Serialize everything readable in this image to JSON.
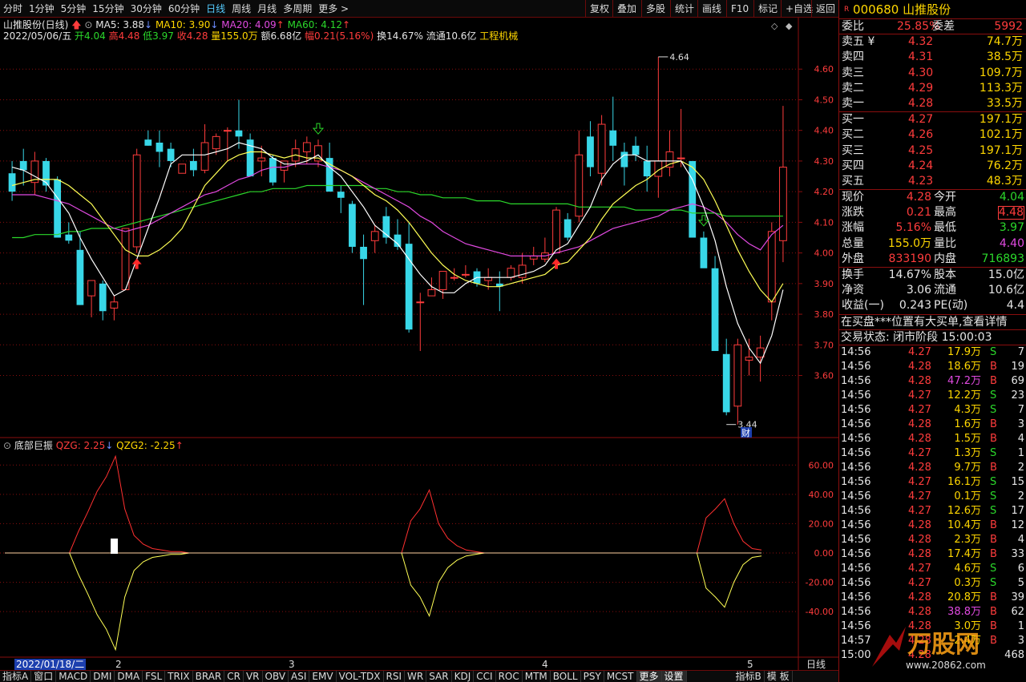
{
  "toolbar": {
    "timeframes": [
      "分时",
      "1分钟",
      "5分钟",
      "15分钟",
      "30分钟",
      "60分钟",
      "日线",
      "周线",
      "月线",
      "多周期",
      "更多 >"
    ],
    "active_timeframe": "日线",
    "buttons": [
      "复权",
      "叠加",
      "多股",
      "统计",
      "画线",
      "F10",
      "标记",
      "+自选",
      "返回"
    ]
  },
  "header": {
    "name_line": "山推股份(日线)",
    "ma5": "MA5: 3.88",
    "ma10": "MA10: 3.90",
    "ma20": "MA20: 4.09",
    "ma60": "MA60: 4.12",
    "date": "2022/05/06/五",
    "open": "开4.04",
    "high": "高4.48",
    "low": "低3.97",
    "close": "收4.28",
    "vol": "量155.0万",
    "amt": "额6.68亿",
    "amp": "幅0.21(5.16%)",
    "turn": "换14.67%",
    "float": "流通10.6亿",
    "industry": "工程机械"
  },
  "indicator": {
    "name": "底部巨振",
    "qzg": "QZG: 2.25",
    "qzg2": "QZG2: -2.25"
  },
  "price_axis": [
    "4.60",
    "4.50",
    "4.40",
    "4.30",
    "4.20",
    "4.10",
    "4.00",
    "3.90",
    "3.80",
    "3.70",
    "3.60"
  ],
  "ind_axis": [
    "60.00",
    "40.00",
    "20.00",
    "0.00",
    "-20.00",
    "-40.00"
  ],
  "annotations": {
    "high": "4.64",
    "low": "3.44",
    "cai": "财"
  },
  "date_strip": {
    "cursor_date": "2022/01/18/二",
    "months": [
      "2",
      "3",
      "4",
      "5"
    ],
    "corner": "日线"
  },
  "bottom_tabs": [
    "指标A",
    "窗口",
    "MACD",
    "DMI",
    "DMA",
    "FSL",
    "TRIX",
    "BRAR",
    "CR",
    "VR",
    "OBV",
    "ASI",
    "EMV",
    "VOL-TDX",
    "RSI",
    "WR",
    "SAR",
    "KDJ",
    "CCI",
    "ROC",
    "MTM",
    "BOLL",
    "PSY",
    "MCST",
    "更多",
    "设置",
    "指标B",
    "模 板"
  ],
  "stock": {
    "code": "000680",
    "name": "山推股份",
    "badge": "R"
  },
  "weibi": {
    "label1": "委比",
    "value1": "25.85%",
    "label2": "委差",
    "value2": "5992"
  },
  "asks": [
    {
      "label": "卖五 ¥",
      "price": "4.32",
      "vol": "74.7万"
    },
    {
      "label": "卖四",
      "price": "4.31",
      "vol": "38.5万"
    },
    {
      "label": "卖三",
      "price": "4.30",
      "vol": "109.7万"
    },
    {
      "label": "卖二",
      "price": "4.29",
      "vol": "113.3万"
    },
    {
      "label": "卖一",
      "price": "4.28",
      "vol": "33.5万"
    }
  ],
  "bids": [
    {
      "label": "买一",
      "price": "4.27",
      "vol": "197.1万"
    },
    {
      "label": "买二",
      "price": "4.26",
      "vol": "102.1万"
    },
    {
      "label": "买三",
      "price": "4.25",
      "vol": "197.1万"
    },
    {
      "label": "买四",
      "price": "4.24",
      "vol": "76.2万"
    },
    {
      "label": "买五",
      "price": "4.23",
      "vol": "48.3万"
    }
  ],
  "quote": [
    {
      "l1": "现价",
      "v1": "4.28",
      "c1": "red",
      "l2": "今开",
      "v2": "4.04",
      "c2": "grn"
    },
    {
      "l1": "涨跌",
      "v1": "0.21",
      "c1": "red",
      "l2": "最高",
      "v2": "4.48",
      "c2": "red",
      "box": true
    },
    {
      "l1": "涨幅",
      "v1": "5.16%",
      "c1": "red",
      "l2": "最低",
      "v2": "3.97",
      "c2": "grn"
    },
    {
      "l1": "总量",
      "v1": "155.0万",
      "c1": "yel",
      "l2": "量比",
      "v2": "4.40",
      "c2": "mag"
    },
    {
      "l1": "外盘",
      "v1": "833190",
      "c1": "red",
      "l2": "内盘",
      "v2": "716893",
      "c2": "grn"
    }
  ],
  "stats": [
    {
      "l1": "换手",
      "v1": "14.67%",
      "l2": "股本",
      "v2": "15.0亿"
    },
    {
      "l1": "净资",
      "v1": "3.06",
      "l2": "流通",
      "v2": "10.6亿"
    },
    {
      "l1": "收益(一)",
      "v1": "0.243",
      "l2": "PE(动)",
      "v2": "4.4"
    }
  ],
  "notice": "在买盘***位置有大买单,查看详情",
  "status": "交易状态: 闭市阶段 15:00:03",
  "ticks": [
    {
      "t": "14:56",
      "p": "4.27",
      "v": "17.9万",
      "s": "S",
      "n": "7"
    },
    {
      "t": "14:56",
      "p": "4.28",
      "v": "18.6万",
      "s": "B",
      "n": "19"
    },
    {
      "t": "14:56",
      "p": "4.28",
      "v": "47.2万",
      "s": "B",
      "n": "69"
    },
    {
      "t": "14:56",
      "p": "4.27",
      "v": "12.2万",
      "s": "S",
      "n": "23"
    },
    {
      "t": "14:56",
      "p": "4.27",
      "v": "4.3万",
      "s": "S",
      "n": "7"
    },
    {
      "t": "14:56",
      "p": "4.28",
      "v": "1.6万",
      "s": "B",
      "n": "3"
    },
    {
      "t": "14:56",
      "p": "4.28",
      "v": "1.5万",
      "s": "B",
      "n": "4"
    },
    {
      "t": "14:56",
      "p": "4.27",
      "v": "1.3万",
      "s": "S",
      "n": "1"
    },
    {
      "t": "14:56",
      "p": "4.28",
      "v": "9.7万",
      "s": "B",
      "n": "2"
    },
    {
      "t": "14:56",
      "p": "4.27",
      "v": "16.1万",
      "s": "S",
      "n": "15"
    },
    {
      "t": "14:56",
      "p": "4.27",
      "v": "0.1万",
      "s": "S",
      "n": "2"
    },
    {
      "t": "14:56",
      "p": "4.27",
      "v": "12.6万",
      "s": "S",
      "n": "17"
    },
    {
      "t": "14:56",
      "p": "4.28",
      "v": "10.4万",
      "s": "B",
      "n": "12"
    },
    {
      "t": "14:56",
      "p": "4.28",
      "v": "2.3万",
      "s": "B",
      "n": "4"
    },
    {
      "t": "14:56",
      "p": "4.28",
      "v": "17.4万",
      "s": "B",
      "n": "33"
    },
    {
      "t": "14:56",
      "p": "4.27",
      "v": "4.6万",
      "s": "S",
      "n": "6"
    },
    {
      "t": "14:56",
      "p": "4.27",
      "v": "0.3万",
      "s": "S",
      "n": "5"
    },
    {
      "t": "14:56",
      "p": "4.28",
      "v": "20.8万",
      "s": "B",
      "n": "39"
    },
    {
      "t": "14:56",
      "p": "4.28",
      "v": "38.8万",
      "s": "B",
      "n": "62"
    },
    {
      "t": "14:56",
      "p": "4.28",
      "v": "3.0万",
      "s": "B",
      "n": "1"
    },
    {
      "t": "14:57",
      "p": "4.28",
      "v": "2.4万",
      "s": "B",
      "n": "3"
    },
    {
      "t": "15:00",
      "p": "4.28",
      "v": "",
      "s": "",
      "n": "468"
    }
  ],
  "colors": {
    "up": "#ff3c3c",
    "down": "#38d7e8",
    "ma5": "#ffffff",
    "ma10": "#ffff55",
    "ma20": "#e14ae1",
    "ma60": "#2bd82b",
    "grid": "#8a0e0e"
  },
  "chart_data": {
    "type": "candlestick",
    "ohlc": [
      [
        4.26,
        4.3,
        4.17,
        4.2
      ],
      [
        4.3,
        4.34,
        4.22,
        4.27
      ],
      [
        4.23,
        4.33,
        4.19,
        4.3
      ],
      [
        4.3,
        4.31,
        4.2,
        4.22
      ],
      [
        4.24,
        4.25,
        4.1,
        4.05
      ],
      [
        4.06,
        4.1,
        4.03,
        4.04
      ],
      [
        4.01,
        4.07,
        3.83,
        3.83
      ],
      [
        3.86,
        3.91,
        3.79,
        3.91
      ],
      [
        3.9,
        3.91,
        3.78,
        3.81
      ],
      [
        3.82,
        3.86,
        3.78,
        3.84
      ],
      [
        3.88,
        4.08,
        3.88,
        4.08
      ],
      [
        4.02,
        4.34,
        4.0,
        4.32
      ],
      [
        4.37,
        4.4,
        4.35,
        4.35
      ],
      [
        4.36,
        4.4,
        4.28,
        4.33
      ],
      [
        4.34,
        4.36,
        4.28,
        4.3
      ],
      [
        4.26,
        4.29,
        4.26,
        4.29
      ],
      [
        4.3,
        4.34,
        4.25,
        4.27
      ],
      [
        4.27,
        4.42,
        4.26,
        4.36
      ],
      [
        4.34,
        4.39,
        4.32,
        4.38
      ],
      [
        4.4,
        4.41,
        4.3,
        4.4
      ],
      [
        4.4,
        4.5,
        4.34,
        4.38
      ],
      [
        4.37,
        4.39,
        4.25,
        4.25
      ],
      [
        4.3,
        4.35,
        4.25,
        4.31
      ],
      [
        4.31,
        4.32,
        4.22,
        4.23
      ],
      [
        4.27,
        4.3,
        4.23,
        4.3
      ],
      [
        4.3,
        4.37,
        4.28,
        4.34
      ],
      [
        4.33,
        4.38,
        4.29,
        4.36
      ],
      [
        4.3,
        4.37,
        4.28,
        4.35
      ],
      [
        4.31,
        4.36,
        4.22,
        4.2
      ],
      [
        4.2,
        4.22,
        4.13,
        4.18
      ],
      [
        4.16,
        4.17,
        4.0,
        4.02
      ],
      [
        4.02,
        4.06,
        3.83,
        3.98
      ],
      [
        4.04,
        4.09,
        4.0,
        4.07
      ],
      [
        4.12,
        4.15,
        4.03,
        4.05
      ],
      [
        4.06,
        4.11,
        4.01,
        4.02
      ],
      [
        4.03,
        4.1,
        3.74,
        3.75
      ],
      [
        3.84,
        3.87,
        3.68,
        3.84
      ],
      [
        3.86,
        3.92,
        3.87,
        3.88
      ],
      [
        3.88,
        3.94,
        3.85,
        3.94
      ],
      [
        3.92,
        3.95,
        3.91,
        3.92
      ],
      [
        3.93,
        3.96,
        3.92,
        3.93
      ],
      [
        3.94,
        3.95,
        3.89,
        3.9
      ],
      [
        3.91,
        3.95,
        3.88,
        3.92
      ],
      [
        3.9,
        3.94,
        3.81,
        3.89
      ],
      [
        3.92,
        3.96,
        3.91,
        3.95
      ],
      [
        3.92,
        4.0,
        3.9,
        3.96
      ],
      [
        3.98,
        4.02,
        3.96,
        3.99
      ],
      [
        3.98,
        4.05,
        3.97,
        4.0
      ],
      [
        4.0,
        4.15,
        4.0,
        4.14
      ],
      [
        4.11,
        4.13,
        4.04,
        4.05
      ],
      [
        4.12,
        4.4,
        4.1,
        4.32
      ],
      [
        4.38,
        4.43,
        4.25,
        4.28
      ],
      [
        4.26,
        4.45,
        4.22,
        4.42
      ],
      [
        4.4,
        4.51,
        4.3,
        4.35
      ],
      [
        4.33,
        4.36,
        4.22,
        4.28
      ],
      [
        4.35,
        4.38,
        4.3,
        4.32
      ],
      [
        4.3,
        4.35,
        4.2,
        4.25
      ],
      [
        4.25,
        4.64,
        4.18,
        4.3
      ],
      [
        4.28,
        4.4,
        4.25,
        4.33
      ],
      [
        4.31,
        4.47,
        4.28,
        4.31
      ],
      [
        4.3,
        4.3,
        4.05,
        4.05
      ],
      [
        4.05,
        4.07,
        3.98,
        3.95
      ],
      [
        3.95,
        3.99,
        3.78,
        3.68
      ],
      [
        3.67,
        3.72,
        3.47,
        3.48
      ],
      [
        3.5,
        3.72,
        3.44,
        3.7
      ],
      [
        3.65,
        3.72,
        3.6,
        3.66
      ],
      [
        3.66,
        3.73,
        3.58,
        3.69
      ],
      [
        3.84,
        4.1,
        3.78,
        4.07
      ],
      [
        4.04,
        4.48,
        3.97,
        4.28
      ]
    ],
    "ma5": [
      4.28,
      4.27,
      4.25,
      4.23,
      4.18,
      4.13,
      4.05,
      3.98,
      3.92,
      3.86,
      3.88,
      3.98,
      4.08,
      4.18,
      4.29,
      4.32,
      4.32,
      4.32,
      4.33,
      4.34,
      4.36,
      4.35,
      4.34,
      4.31,
      4.29,
      4.29,
      4.3,
      4.32,
      4.28,
      4.25,
      4.2,
      4.15,
      4.09,
      4.06,
      4.03,
      3.98,
      3.93,
      3.89,
      3.87,
      3.87,
      3.9,
      3.92,
      3.92,
      3.92,
      3.92,
      3.93,
      3.94,
      3.96,
      4.01,
      4.03,
      4.09,
      4.15,
      4.24,
      4.29,
      4.32,
      4.32,
      4.3,
      4.3,
      4.3,
      4.3,
      4.24,
      4.15,
      4.04,
      3.89,
      3.77,
      3.69,
      3.64,
      3.73,
      3.88
    ],
    "ma10": [
      4.22,
      4.23,
      4.24,
      4.24,
      4.24,
      4.22,
      4.19,
      4.16,
      4.11,
      4.06,
      4.01,
      3.99,
      3.99,
      4.01,
      4.04,
      4.08,
      4.15,
      4.22,
      4.26,
      4.3,
      4.32,
      4.33,
      4.33,
      4.32,
      4.31,
      4.32,
      4.31,
      4.31,
      4.29,
      4.27,
      4.25,
      4.22,
      4.19,
      4.17,
      4.14,
      4.1,
      4.05,
      4.0,
      3.96,
      3.93,
      3.91,
      3.9,
      3.89,
      3.89,
      3.9,
      3.91,
      3.92,
      3.93,
      3.96,
      3.97,
      4.01,
      4.05,
      4.11,
      4.16,
      4.19,
      4.22,
      4.24,
      4.27,
      4.29,
      4.3,
      4.28,
      4.24,
      4.17,
      4.09,
      4.01,
      3.94,
      3.88,
      3.84,
      3.9
    ],
    "ma20": [
      4.19,
      4.19,
      4.19,
      4.18,
      4.17,
      4.16,
      4.14,
      4.12,
      4.1,
      4.08,
      4.07,
      4.08,
      4.09,
      4.11,
      4.13,
      4.15,
      4.17,
      4.19,
      4.2,
      4.22,
      4.24,
      4.25,
      4.27,
      4.28,
      4.28,
      4.29,
      4.29,
      4.29,
      4.28,
      4.27,
      4.25,
      4.23,
      4.21,
      4.19,
      4.17,
      4.15,
      4.12,
      4.1,
      4.07,
      4.05,
      4.03,
      4.02,
      4.01,
      4.0,
      3.99,
      3.99,
      3.99,
      3.99,
      4.0,
      4.01,
      4.02,
      4.04,
      4.06,
      4.08,
      4.09,
      4.1,
      4.11,
      4.12,
      4.14,
      4.15,
      4.16,
      4.15,
      4.13,
      4.1,
      4.06,
      4.03,
      4.01,
      4.06,
      4.09
    ],
    "ma60": [
      4.05,
      4.05,
      4.06,
      4.06,
      4.06,
      4.07,
      4.07,
      4.08,
      4.08,
      4.08,
      4.09,
      4.1,
      4.11,
      4.12,
      4.13,
      4.14,
      4.15,
      4.16,
      4.17,
      4.18,
      4.19,
      4.2,
      4.2,
      4.21,
      4.21,
      4.21,
      4.22,
      4.22,
      4.22,
      4.22,
      4.22,
      4.22,
      4.21,
      4.21,
      4.2,
      4.2,
      4.19,
      4.19,
      4.18,
      4.18,
      4.18,
      4.17,
      4.17,
      4.17,
      4.16,
      4.16,
      4.16,
      4.16,
      4.16,
      4.16,
      4.15,
      4.15,
      4.15,
      4.15,
      4.15,
      4.14,
      4.14,
      4.14,
      4.14,
      4.14,
      4.13,
      4.13,
      4.13,
      4.12,
      4.12,
      4.12,
      4.12,
      4.12,
      4.12
    ],
    "qzg": [
      0,
      0,
      0,
      0,
      0,
      0,
      0,
      0,
      15,
      28,
      42,
      52,
      66,
      30,
      12,
      6,
      3,
      2,
      1,
      1,
      0,
      0,
      0,
      0,
      0,
      0,
      0,
      0,
      0,
      0,
      0,
      0,
      0,
      0,
      0,
      0,
      0,
      0,
      0,
      0,
      0,
      0,
      0,
      0,
      22,
      30,
      43,
      20,
      10,
      5,
      2,
      1,
      0,
      0,
      0,
      0,
      0,
      0,
      0,
      0,
      0,
      0,
      0,
      0,
      0,
      0,
      0,
      0,
      0,
      0,
      0,
      0,
      0,
      0,
      0,
      0,
      24,
      30,
      37,
      20,
      8,
      3,
      2
    ],
    "ylim": [
      3.4,
      4.7
    ],
    "ind_ylim": [
      -70,
      70
    ]
  }
}
